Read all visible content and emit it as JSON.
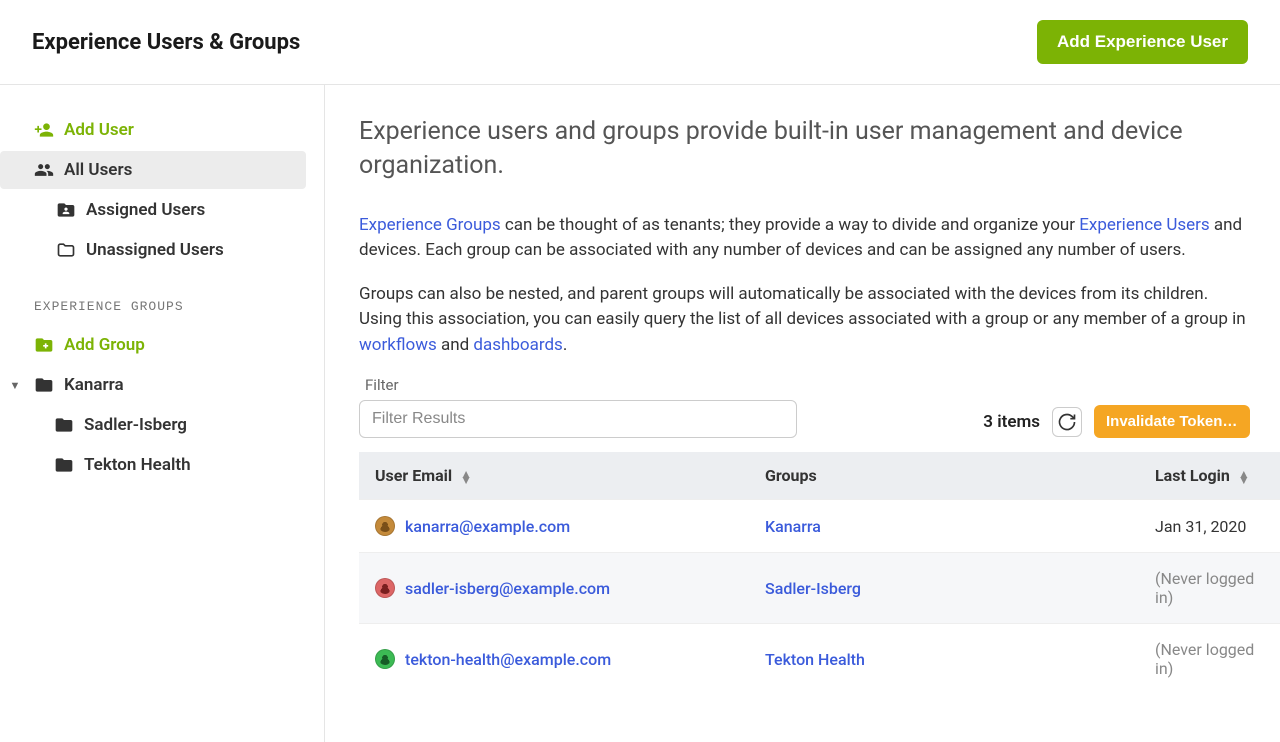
{
  "header": {
    "title": "Experience Users & Groups",
    "add_button": "Add Experience User"
  },
  "sidebar": {
    "add_user": "Add User",
    "all_users": "All Users",
    "assigned_users": "Assigned Users",
    "unassigned_users": "Unassigned Users",
    "groups_section_label": "EXPERIENCE GROUPS",
    "add_group": "Add Group",
    "groups": [
      {
        "name": "Kanarra",
        "children": [
          {
            "name": "Sadler-Isberg"
          },
          {
            "name": "Tekton Health"
          }
        ]
      }
    ]
  },
  "main": {
    "intro": "Experience users and groups provide built-in user management and device organization.",
    "p1_prefix_link": "Experience Groups",
    "p1_mid1": " can be thought of as tenants; they provide a way to divide and organize your ",
    "p1_link2": "Experience Users",
    "p1_tail": " and devices. Each group can be associated with any number of devices and can be assigned any number of users.",
    "p2_a": "Groups can also be nested, and parent groups will automatically be associated with the devices from its children. Using this association, you can easily query the list of all devices associated with a group or any member of a group in ",
    "p2_link_workflows": "workflows",
    "p2_and": " and ",
    "p2_link_dashboards": "dashboards",
    "p2_end": ".",
    "filter_label": "Filter",
    "filter_placeholder": "Filter Results",
    "item_count": "3 items",
    "invalidate_label": "Invalidate Tokens ...",
    "columns": {
      "email": "User Email",
      "groups": "Groups",
      "last_login": "Last Login"
    },
    "rows": [
      {
        "email": "kanarra@example.com",
        "group": "Kanarra",
        "last_login": "Jan 31, 2020",
        "muted": false,
        "avatar": "c1"
      },
      {
        "email": "sadler-isberg@example.com",
        "group": "Sadler-Isberg",
        "last_login": "(Never logged in)",
        "muted": true,
        "avatar": "c2"
      },
      {
        "email": "tekton-health@example.com",
        "group": "Tekton Health",
        "last_login": "(Never logged in)",
        "muted": true,
        "avatar": "c3"
      }
    ]
  }
}
